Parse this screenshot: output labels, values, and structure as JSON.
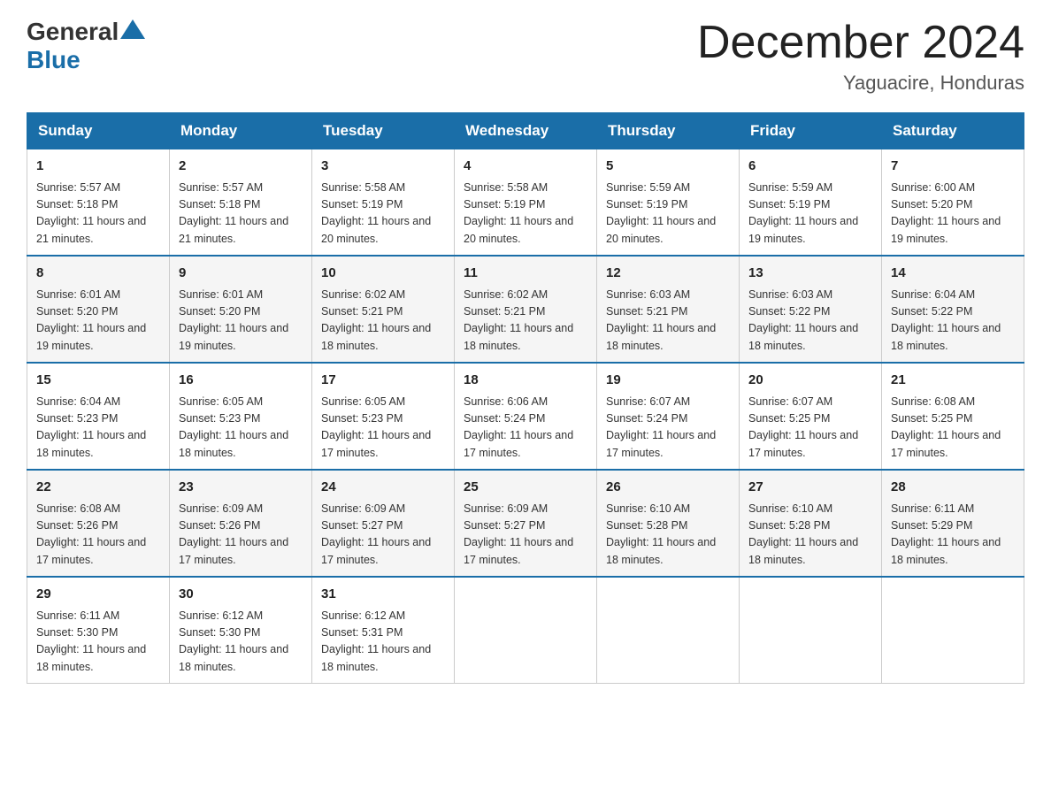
{
  "header": {
    "logo_general": "General",
    "logo_blue": "Blue",
    "month": "December 2024",
    "location": "Yaguacire, Honduras"
  },
  "weekdays": [
    "Sunday",
    "Monday",
    "Tuesday",
    "Wednesday",
    "Thursday",
    "Friday",
    "Saturday"
  ],
  "weeks": [
    [
      {
        "day": "1",
        "sunrise": "5:57 AM",
        "sunset": "5:18 PM",
        "daylight": "11 hours and 21 minutes."
      },
      {
        "day": "2",
        "sunrise": "5:57 AM",
        "sunset": "5:18 PM",
        "daylight": "11 hours and 21 minutes."
      },
      {
        "day": "3",
        "sunrise": "5:58 AM",
        "sunset": "5:19 PM",
        "daylight": "11 hours and 20 minutes."
      },
      {
        "day": "4",
        "sunrise": "5:58 AM",
        "sunset": "5:19 PM",
        "daylight": "11 hours and 20 minutes."
      },
      {
        "day": "5",
        "sunrise": "5:59 AM",
        "sunset": "5:19 PM",
        "daylight": "11 hours and 20 minutes."
      },
      {
        "day": "6",
        "sunrise": "5:59 AM",
        "sunset": "5:19 PM",
        "daylight": "11 hours and 19 minutes."
      },
      {
        "day": "7",
        "sunrise": "6:00 AM",
        "sunset": "5:20 PM",
        "daylight": "11 hours and 19 minutes."
      }
    ],
    [
      {
        "day": "8",
        "sunrise": "6:01 AM",
        "sunset": "5:20 PM",
        "daylight": "11 hours and 19 minutes."
      },
      {
        "day": "9",
        "sunrise": "6:01 AM",
        "sunset": "5:20 PM",
        "daylight": "11 hours and 19 minutes."
      },
      {
        "day": "10",
        "sunrise": "6:02 AM",
        "sunset": "5:21 PM",
        "daylight": "11 hours and 18 minutes."
      },
      {
        "day": "11",
        "sunrise": "6:02 AM",
        "sunset": "5:21 PM",
        "daylight": "11 hours and 18 minutes."
      },
      {
        "day": "12",
        "sunrise": "6:03 AM",
        "sunset": "5:21 PM",
        "daylight": "11 hours and 18 minutes."
      },
      {
        "day": "13",
        "sunrise": "6:03 AM",
        "sunset": "5:22 PM",
        "daylight": "11 hours and 18 minutes."
      },
      {
        "day": "14",
        "sunrise": "6:04 AM",
        "sunset": "5:22 PM",
        "daylight": "11 hours and 18 minutes."
      }
    ],
    [
      {
        "day": "15",
        "sunrise": "6:04 AM",
        "sunset": "5:23 PM",
        "daylight": "11 hours and 18 minutes."
      },
      {
        "day": "16",
        "sunrise": "6:05 AM",
        "sunset": "5:23 PM",
        "daylight": "11 hours and 18 minutes."
      },
      {
        "day": "17",
        "sunrise": "6:05 AM",
        "sunset": "5:23 PM",
        "daylight": "11 hours and 17 minutes."
      },
      {
        "day": "18",
        "sunrise": "6:06 AM",
        "sunset": "5:24 PM",
        "daylight": "11 hours and 17 minutes."
      },
      {
        "day": "19",
        "sunrise": "6:07 AM",
        "sunset": "5:24 PM",
        "daylight": "11 hours and 17 minutes."
      },
      {
        "day": "20",
        "sunrise": "6:07 AM",
        "sunset": "5:25 PM",
        "daylight": "11 hours and 17 minutes."
      },
      {
        "day": "21",
        "sunrise": "6:08 AM",
        "sunset": "5:25 PM",
        "daylight": "11 hours and 17 minutes."
      }
    ],
    [
      {
        "day": "22",
        "sunrise": "6:08 AM",
        "sunset": "5:26 PM",
        "daylight": "11 hours and 17 minutes."
      },
      {
        "day": "23",
        "sunrise": "6:09 AM",
        "sunset": "5:26 PM",
        "daylight": "11 hours and 17 minutes."
      },
      {
        "day": "24",
        "sunrise": "6:09 AM",
        "sunset": "5:27 PM",
        "daylight": "11 hours and 17 minutes."
      },
      {
        "day": "25",
        "sunrise": "6:09 AM",
        "sunset": "5:27 PM",
        "daylight": "11 hours and 17 minutes."
      },
      {
        "day": "26",
        "sunrise": "6:10 AM",
        "sunset": "5:28 PM",
        "daylight": "11 hours and 18 minutes."
      },
      {
        "day": "27",
        "sunrise": "6:10 AM",
        "sunset": "5:28 PM",
        "daylight": "11 hours and 18 minutes."
      },
      {
        "day": "28",
        "sunrise": "6:11 AM",
        "sunset": "5:29 PM",
        "daylight": "11 hours and 18 minutes."
      }
    ],
    [
      {
        "day": "29",
        "sunrise": "6:11 AM",
        "sunset": "5:30 PM",
        "daylight": "11 hours and 18 minutes."
      },
      {
        "day": "30",
        "sunrise": "6:12 AM",
        "sunset": "5:30 PM",
        "daylight": "11 hours and 18 minutes."
      },
      {
        "day": "31",
        "sunrise": "6:12 AM",
        "sunset": "5:31 PM",
        "daylight": "11 hours and 18 minutes."
      },
      null,
      null,
      null,
      null
    ]
  ]
}
